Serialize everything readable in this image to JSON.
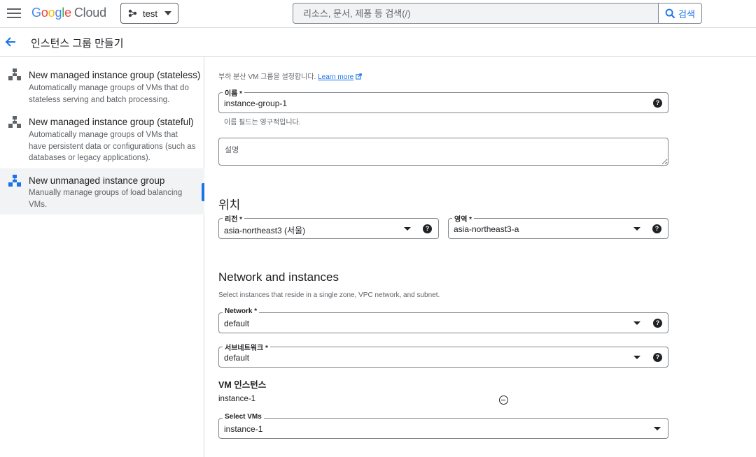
{
  "topbar": {
    "logo_letters": [
      "G",
      "o",
      "o",
      "g",
      "l",
      "e"
    ],
    "logo_cloud": "Cloud",
    "project": "test",
    "search_placeholder": "리소스, 문서, 제품 등 검색(/)",
    "search_button": "검색"
  },
  "page": {
    "title": "인스턴스 그룹 만들기"
  },
  "options": [
    {
      "title": "New managed instance group (stateless)",
      "desc": "Automatically manage groups of VMs that do stateless serving and batch processing.",
      "selected": false
    },
    {
      "title": "New managed instance group (stateful)",
      "desc": "Automatically manage groups of VMs that have persistent data or configurations (such as databases or legacy applications).",
      "selected": false
    },
    {
      "title": "New unmanaged instance group",
      "desc": "Manually manage groups of load balancing VMs.",
      "selected": true
    }
  ],
  "form": {
    "intro": "부하 분산 VM 그룹을 설정합니다.",
    "learn_more": "Learn more",
    "name": {
      "label": "이름 *",
      "value": "instance-group-1",
      "hint": "이름 필드는 영구적입니다."
    },
    "description": {
      "placeholder": "설명"
    },
    "location": {
      "heading": "위치",
      "region": {
        "label": "리전 *",
        "value": "asia-northeast3 (서울)"
      },
      "zone": {
        "label": "영역 *",
        "value": "asia-northeast3-a"
      }
    },
    "network_section": {
      "heading": "Network and instances",
      "desc": "Select instances that reside in a single zone, VPC network, and subnet.",
      "network": {
        "label": "Network *",
        "value": "default"
      },
      "subnetwork": {
        "label": "서브네트워크 *",
        "value": "default"
      }
    },
    "vm_section": {
      "heading": "VM 인스턴스",
      "instances": [
        "instance-1"
      ],
      "select": {
        "label": "Select VMs",
        "value": "instance-1"
      }
    }
  },
  "colors": {
    "accent": "#1a73e8",
    "border": "#80868b",
    "selected_bg": "#f1f3f4"
  }
}
